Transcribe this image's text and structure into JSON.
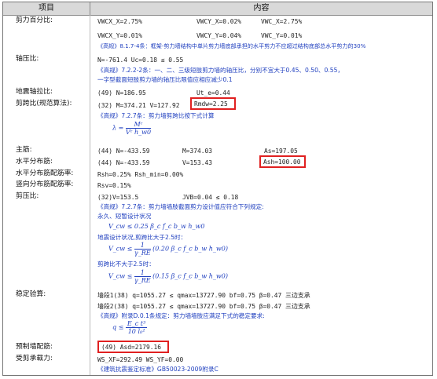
{
  "header": {
    "col_item": "项目",
    "col_content": "内容"
  },
  "rows": {
    "shear_pct": {
      "label": "剪力百分比:",
      "vwcx_x": "VWCX_X=2.75%",
      "vwcy_x": "VWCY_X=0.02%",
      "vwc_x": "VWC_X=2.75%",
      "vwcx_y": "VWCX_Y=0.01%",
      "vwcy_y": "VWCY_Y=0.04%",
      "vwc_y": "VWC_Y=0.01%",
      "note": "《高规》8.1.7-4条：框架-剪力墙结构中单片剪力墙底部承担的水平剪力不应超过结构底部总水平剪力的30%"
    },
    "axial": {
      "label": "轴压比:",
      "values": "N=-761.4   Uc=0.18 ≤ 0.55",
      "note1": "《高规》7.2.2-2条：一、二、三级短肢剪力墙的轴压比，分别不宜大于0.45、0.50、0.55，",
      "note2": "一字型截面短肢剪力墙的轴压比限值应相应减少0.1"
    },
    "seismic_tension": {
      "label": "地震轴拉比:",
      "left": "(49)  N=186.95",
      "right": "Ut_e=0.44"
    },
    "shear_span": {
      "label": "剪跨比(规范算法):",
      "values": "(32)  M=374.21  V=127.92",
      "rmdw": "Rmdw=2.25",
      "note": "《高规》7.2.7条：剪力墙剪跨比按下式计算"
    },
    "main_bar": {
      "label": "主筋:",
      "left": "(44) N=-433.59",
      "mid": "M=374.03",
      "right": "As=197.05"
    },
    "horiz_bar": {
      "label": "水平分布筋:",
      "left": "(44) N=-433.59",
      "mid": "V=153.43",
      "ash": "Ash=100.00"
    },
    "horiz_ratio": {
      "label": "水平分布筋配筋率:",
      "value": "Rsh=0.25%  Rsh_min=0.00%"
    },
    "vert_ratio": {
      "label": "竖向分布筋配筋率:",
      "value": "Rsv=0.15%"
    },
    "shear_pressure": {
      "label": "剪压比:",
      "left": "(32)V=153.5",
      "right": "JVB=0.04 ≤ 0.18",
      "note": "《高规》7.2.7条：剪力墙墙肢截面剪力设计值应符合下列规定:",
      "case1": "永久、短暂设计状况",
      "case2": "地震设计状况,剪跨比大于2.5时：",
      "case3": "剪跨比不大于2.5时："
    },
    "stability": {
      "label": "稳定验算:",
      "line1": "墙段1(38) q=1055.27 ≤ qmax=13727.90  bf=0.75  β=0.47  三边支承",
      "line2": "墙段2(38) q=1055.27 ≤ qmax=13727.90  bf=0.75  β=0.47  三边支承",
      "note": "《高规》附录D.0.1条规定：剪力墙墙肢应满足下式的稳定要求:"
    },
    "preset": {
      "label": "预制墙配筋:",
      "value": "(49) Asd=2179.16"
    },
    "shear_capacity": {
      "label": "受剪承载力:",
      "value": "WS_XF=292.49  WS_YF=0.00",
      "note": "《建筑抗震鉴定标准》GB50023-2009附录C"
    }
  },
  "formulas": {
    "lambda_eq": "λ =",
    "lambda_num": "Mᶜ",
    "lambda_den": "Vᶜ h_w0",
    "f1": "V_cw ≤ 0.25 β_c f_c b_w h_w0",
    "f2_pre": "V_cw ≤",
    "f2_one": "1",
    "f2_gamma": "γ_RE",
    "f2_post": "(0.20 β_c f_c b_w h_w0)",
    "f3_pre": "V_cw ≤",
    "f3_one": "1",
    "f3_gamma": "γ_RE",
    "f3_post": "(0.15 β_c f_c b_w h_w0)",
    "q_pre": "q ≤",
    "q_num": "E_c t³",
    "q_den": "10 l₀²"
  },
  "colors": {
    "highlight": "#e02020",
    "note_blue": "#1f3fbf",
    "header_bg": "#d9d9d9"
  }
}
